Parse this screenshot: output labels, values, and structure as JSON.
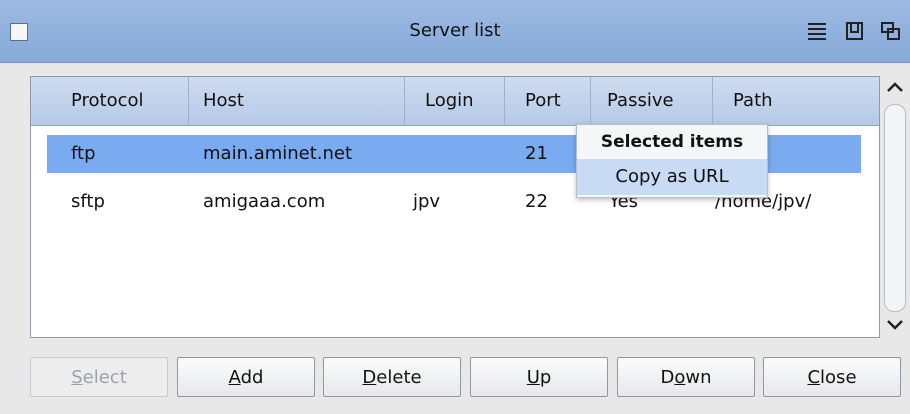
{
  "window": {
    "title": "Server list",
    "titlebar_icons": [
      "menu-icon",
      "iconify-icon",
      "depth-icon"
    ]
  },
  "table": {
    "columns": [
      "Protocol",
      "Host",
      "Login",
      "Port",
      "Passive",
      "Path"
    ],
    "rows": [
      {
        "protocol": "ftp",
        "host": "main.aminet.net",
        "login": "",
        "port": "21",
        "passive": "",
        "path": "",
        "selected": true
      },
      {
        "protocol": "sftp",
        "host": "amigaaa.com",
        "login": "jpv",
        "port": "22",
        "passive": "Yes",
        "path": "/home/jpv/",
        "selected": false
      }
    ]
  },
  "context_menu": {
    "header": "Selected items",
    "items": [
      "Copy as URL"
    ]
  },
  "buttons": {
    "select": {
      "before": "",
      "key": "S",
      "after": "elect"
    },
    "add": {
      "before": "",
      "key": "A",
      "after": "dd"
    },
    "delete": {
      "before": "",
      "key": "D",
      "after": "elete"
    },
    "up": {
      "before": "",
      "key": "U",
      "after": "p"
    },
    "down": {
      "before": "D",
      "key": "o",
      "after": "wn"
    },
    "close": {
      "before": "",
      "key": "C",
      "after": "lose"
    }
  },
  "colors": {
    "titlebar": "#8fb0dc",
    "selection": "#7aaaf0",
    "header": "#c2d3ee"
  }
}
